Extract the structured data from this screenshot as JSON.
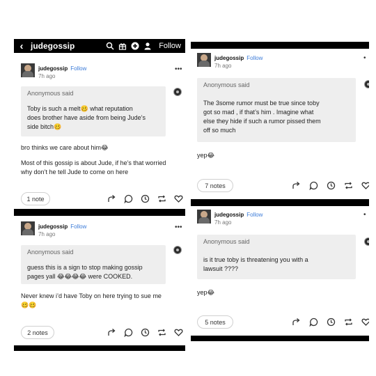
{
  "topbar": {
    "back_icon": "chevron-left-icon",
    "blog_name": "judegossip",
    "follow_label": "Follow",
    "icons": [
      "search-icon",
      "gift-icon",
      "plus-circle-icon",
      "user-icon"
    ]
  },
  "posts": [
    {
      "blog": "judegossip",
      "follow": "Follow",
      "time": "7h ago",
      "asker": "Anonymous said",
      "question": [
        "Toby is such a melt🥴 what reputation",
        "does brother have aside from being Jude’s",
        "side bitch🥴"
      ],
      "answer": [
        "bro thinks we care about him😂",
        "",
        "Most of this gossip is about Jude, if he’s that worried",
        "why don’t he tell Jude to come on here"
      ],
      "notes": "1 note"
    },
    {
      "blog": "judegossip",
      "follow": "Follow",
      "time": "7h ago",
      "asker": "Anonymous said",
      "question": [
        "guess this is a sign to stop making gossip",
        "pages yall 😂😂😂😂 were COOKED."
      ],
      "answer": [
        "Never knew i’d have Toby on here trying to sue me",
        "🥴🥴"
      ],
      "notes": "2 notes"
    },
    {
      "blog": "judegossip",
      "follow": "Follow",
      "time": "7h ago",
      "asker": "Anonymous said",
      "question": [
        "The 3some rumor must be true since toby",
        "got so mad , if that’s him . Imagine what",
        "else they hide if such a rumor pissed them",
        "off so much"
      ],
      "answer": [
        "yep😂"
      ],
      "notes": "7 notes"
    },
    {
      "blog": "judegossip",
      "follow": "Follow",
      "time": "7h ago",
      "asker": "Anonymous said",
      "question": [
        "is it true toby is threatening you with a",
        "lawsuit ????"
      ],
      "answer": [
        "yep😂"
      ],
      "notes": "5 notes"
    }
  ],
  "action_icons": [
    "share-icon",
    "reply-icon",
    "clock-icon",
    "reblog-icon",
    "heart-icon"
  ],
  "colors": {
    "follow_blue": "#3b7bd8",
    "ask_bg": "#eeeeee",
    "bar": "#000000"
  }
}
